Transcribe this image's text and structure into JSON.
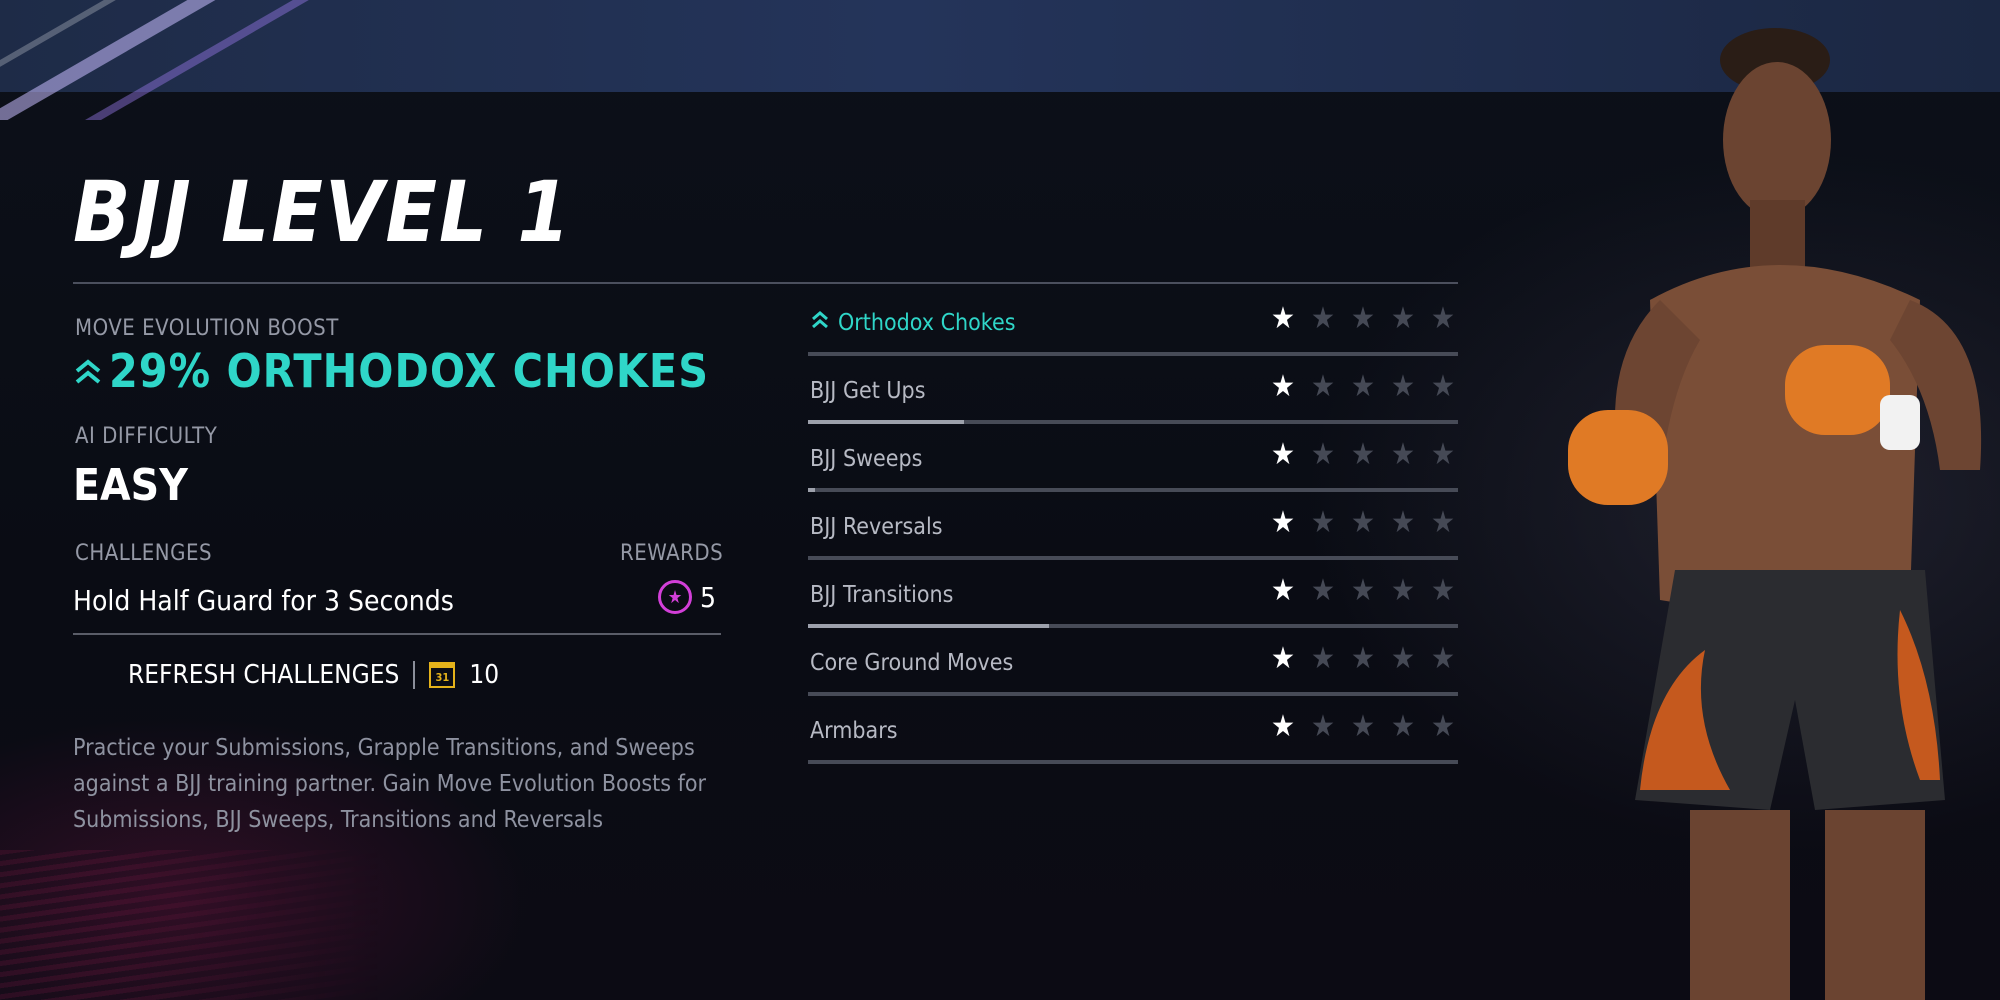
{
  "screen": {
    "title": "BJJ LEVEL 1"
  },
  "boost": {
    "label": "MOVE EVOLUTION BOOST",
    "value": "29% ORTHODOX CHOKES",
    "icon": "double-chevron-up-icon",
    "color": "#2fd6c8"
  },
  "difficulty": {
    "label": "AI DIFFICULTY",
    "value": "EASY"
  },
  "challenges": {
    "label": "CHALLENGES",
    "rewards_label": "REWARDS",
    "items": [
      {
        "text": "Hold Half Guard for 3 Seconds",
        "reward": "5",
        "reward_icon": "star-coin-icon"
      }
    ],
    "refresh_label": "REFRESH CHALLENGES",
    "refresh_cost": "10",
    "refresh_icon": "calendar-icon"
  },
  "description": "Practice your Submissions, Grapple Transitions, and Sweeps against a BJJ training partner. Gain Move Evolution Boosts for Submissions, BJJ Sweeps, Transitions and Reversals",
  "calendar_day": "31",
  "moves": [
    {
      "name": "Orthodox Chokes",
      "stars": 1,
      "max_stars": 5,
      "progress": 0.0,
      "boosted": true
    },
    {
      "name": "BJJ Get Ups",
      "stars": 1,
      "max_stars": 5,
      "progress": 0.24,
      "boosted": false
    },
    {
      "name": "BJJ Sweeps",
      "stars": 1,
      "max_stars": 5,
      "progress": 0.01,
      "boosted": false
    },
    {
      "name": "BJJ Reversals",
      "stars": 1,
      "max_stars": 5,
      "progress": 0.0,
      "boosted": false
    },
    {
      "name": "BJJ Transitions",
      "stars": 1,
      "max_stars": 5,
      "progress": 0.37,
      "boosted": false
    },
    {
      "name": "Core Ground Moves",
      "stars": 1,
      "max_stars": 5,
      "progress": 0.0,
      "boosted": false
    },
    {
      "name": "Armbars",
      "stars": 1,
      "max_stars": 5,
      "progress": 0.0,
      "boosted": false
    }
  ],
  "colors": {
    "accent": "#2fd6c8",
    "reward": "#d23fd8",
    "calendar": "#e4b21a"
  }
}
